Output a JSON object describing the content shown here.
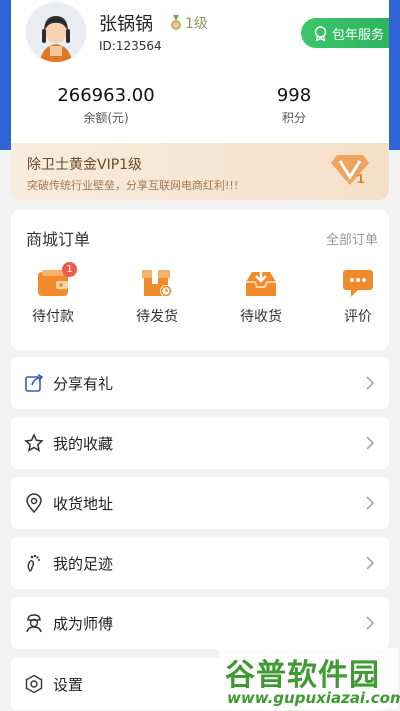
{
  "profile": {
    "name": "张锅锅",
    "level": "1级",
    "id": "ID:123564",
    "service_button": "包年服务"
  },
  "stats": [
    {
      "value": "266963.00",
      "label": "余额(元)"
    },
    {
      "value": "998",
      "label": "积分"
    }
  ],
  "vip": {
    "title": "除卫士黄金VIP1级",
    "subtitle": "突破传统行业壁垒，分享互联网电商红利!!!"
  },
  "orders": {
    "title": "商城订单",
    "all_label": "全部订单",
    "items": [
      {
        "label": "待付款",
        "badge": "1",
        "icon": "wallet-icon"
      },
      {
        "label": "待发货",
        "icon": "box-clock-icon"
      },
      {
        "label": "待收货",
        "icon": "inbox-download-icon"
      },
      {
        "label": "评价",
        "icon": "chat-dots-icon"
      }
    ]
  },
  "menu": [
    {
      "label": "分享有礼",
      "icon": "share-icon"
    },
    {
      "label": "我的收藏",
      "icon": "star-icon"
    },
    {
      "label": "收货地址",
      "icon": "location-icon"
    },
    {
      "label": "我的足迹",
      "icon": "footprint-icon"
    },
    {
      "label": "成为师傅",
      "icon": "worker-icon"
    },
    {
      "label": "设置",
      "icon": "settings-icon"
    }
  ],
  "watermark": {
    "title": "谷普软件园",
    "url": "www.gupuxiazai.com"
  },
  "colors": {
    "header_blue": "#2f63d6",
    "service_green": "#2db45d",
    "order_orange": "#f08a2a",
    "badge_red": "#f05a4a"
  }
}
